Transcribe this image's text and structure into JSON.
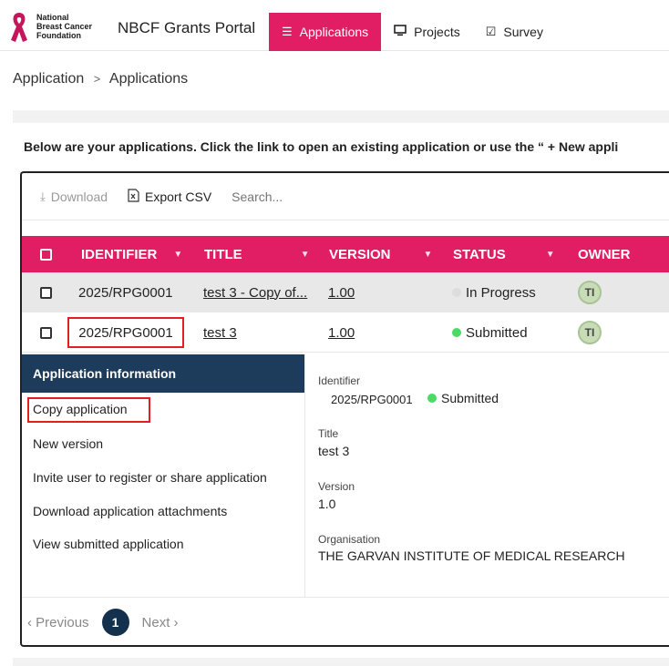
{
  "logo": {
    "line1": "National",
    "line2": "Breast Cancer",
    "line3": "Foundation",
    "ribbon_color": "#c2185b"
  },
  "app_title": "NBCF Grants Portal",
  "nav": [
    {
      "label": "Applications",
      "icon": "list-icon",
      "active": true
    },
    {
      "label": "Projects",
      "icon": "monitor-icon",
      "active": false
    },
    {
      "label": "Survey",
      "icon": "checkbox-icon",
      "active": false
    }
  ],
  "breadcrumb": {
    "root": "Application",
    "separator": ">",
    "current": "Applications"
  },
  "intro": "Below are your applications. Click the link to open an existing application or use the “ + New appli",
  "toolbar": {
    "download": "Download",
    "export": "Export CSV",
    "search_placeholder": "Search..."
  },
  "columns": [
    "IDENTIFIER",
    "TITLE",
    "VERSION",
    "STATUS",
    "OWNER"
  ],
  "rows": [
    {
      "identifier": "2025/RPG0001",
      "title": "test 3 - Copy of...",
      "version": "1.00",
      "status": "In Progress",
      "status_color": "#dddddd",
      "owner": "TI"
    },
    {
      "identifier": "2025/RPG0001",
      "title": "test 3",
      "version": "1.00",
      "status": "Submitted",
      "status_color": "#4cd964",
      "owner": "TI"
    }
  ],
  "side": {
    "heading": "Application information",
    "items": [
      "Copy application",
      "New version",
      "Invite user to register or share application",
      "Download application attachments",
      "View submitted application"
    ]
  },
  "info": {
    "identifier_label": "Identifier",
    "identifier": "2025/RPG0001",
    "status": "Submitted",
    "title_label": "Title",
    "title": "test 3",
    "version_label": "Version",
    "version": "1.0",
    "org_label": "Organisation",
    "org": "THE GARVAN INSTITUTE OF MEDICAL RESEARCH"
  },
  "pager": {
    "previous": "Previous",
    "page": "1",
    "next": "Next"
  },
  "colors": {
    "accent": "#e11d63",
    "side_heading": "#1d3c5c",
    "highlight": "#e02020"
  }
}
